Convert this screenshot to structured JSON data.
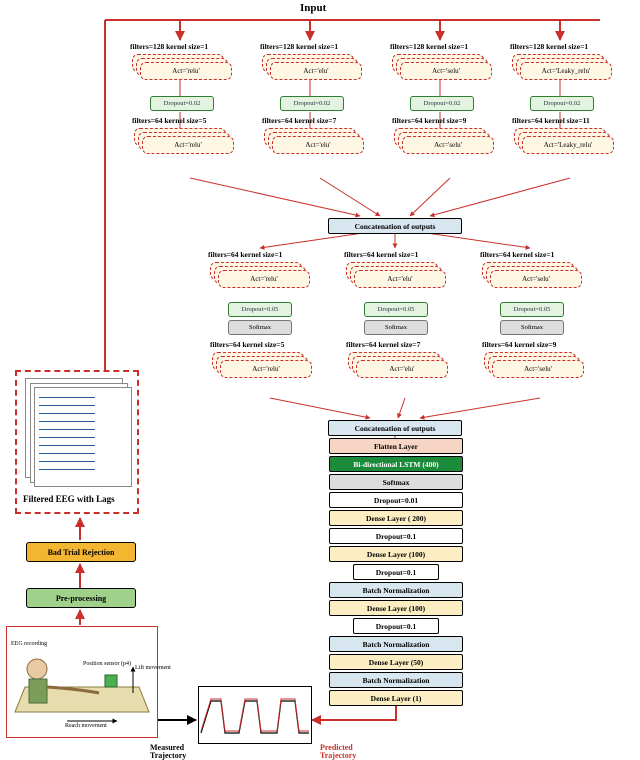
{
  "title": "Input",
  "level1": {
    "branches": [
      {
        "header": "filters=128  kernel size=1",
        "act": "Act='relu'",
        "drop": "Dropout=0.02",
        "h2": "filters=64  kernel size=5",
        "act2": "Act='relu'"
      },
      {
        "header": "filters=128  kernel size=1",
        "act": "Act='elu'",
        "drop": "Dropout=0.02",
        "h2": "filters=64  kernel size=7",
        "act2": "Act='elu'"
      },
      {
        "header": "filters=128  kernel size=1",
        "act": "Act='selu'",
        "drop": "Dropout=0.02",
        "h2": "filters=64  kernel size=9",
        "act2": "Act='selu'"
      },
      {
        "header": "filters=128  kernel size=1",
        "act": "Act='Leaky_relu'",
        "drop": "Dropout=0.02",
        "h2": "filters=64  kernel size=11",
        "act2": "Act='Leaky_relu'"
      }
    ],
    "concat": "Concatenation of outputs"
  },
  "level2": {
    "branches": [
      {
        "header": "filters=64  kernel size=1",
        "act": "Act='relu'",
        "drop": "Dropout=0.05",
        "soft": "Softmax",
        "h2": "filters=64  kernel size=5",
        "act2": "Act='relu'"
      },
      {
        "header": "filters=64  kernel size=1",
        "act": "Act='elu'",
        "drop": "Dropout=0.05",
        "soft": "Softmax",
        "h2": "filters=64  kernel size=7",
        "act2": "Act='elu'"
      },
      {
        "header": "filters=64  kernel size=1",
        "act": "Act='selu'",
        "drop": "Dropout=0.05",
        "soft": "Softmax",
        "h2": "filters=64  kernel size=9",
        "act2": "Act='selu'"
      }
    ],
    "concat": "Concatenation of outputs"
  },
  "tail": [
    {
      "t": "Flatten Layer",
      "bg": "#f6d5c4"
    },
    {
      "t": "Bi-directional LSTM (400)",
      "bg": "#1b8a3a",
      "fg": "#fff"
    },
    {
      "t": "Softmax",
      "bg": "#ddd"
    },
    {
      "t": "Dropout=0.01",
      "bg": "#fff"
    },
    {
      "t": "Dense Layer ( 200)",
      "bg": "#fceec2"
    },
    {
      "t": "Dropout=0.1",
      "bg": "#fff"
    },
    {
      "t": "Dense Layer (100)",
      "bg": "#fceec2"
    },
    {
      "t": "Dropout=0.1",
      "bg": "#fff",
      "narrow": true
    },
    {
      "t": "Batch Normalization",
      "bg": "#d7e6ef"
    },
    {
      "t": "Dense Layer (100)",
      "bg": "#fceec2"
    },
    {
      "t": "Dropout=0.1",
      "bg": "#fff",
      "narrow": true
    },
    {
      "t": "Batch Normalization",
      "bg": "#d7e6ef"
    },
    {
      "t": "Dense Layer (50)",
      "bg": "#fceec2"
    },
    {
      "t": "Batch Normalization",
      "bg": "#d7e6ef"
    },
    {
      "t": "Dense Layer (1)",
      "bg": "#fceec2"
    }
  ],
  "pipe": {
    "bad": "Bad Trial Rejection",
    "pre": "Pre-processing",
    "eeg": "Filtered EEG with Lags"
  },
  "exp": {
    "eeg_rec": "EEG recording",
    "pos": "Position sensor (p4)",
    "lift": "Lift movement",
    "reach": "Reach movement"
  },
  "traj": {
    "meas": "Measured Trajectory",
    "pred": "Predicted Trajectory"
  },
  "colors": {
    "red": "#c9302c",
    "green": "#2e7d32",
    "blue": "#2a5c9a"
  }
}
